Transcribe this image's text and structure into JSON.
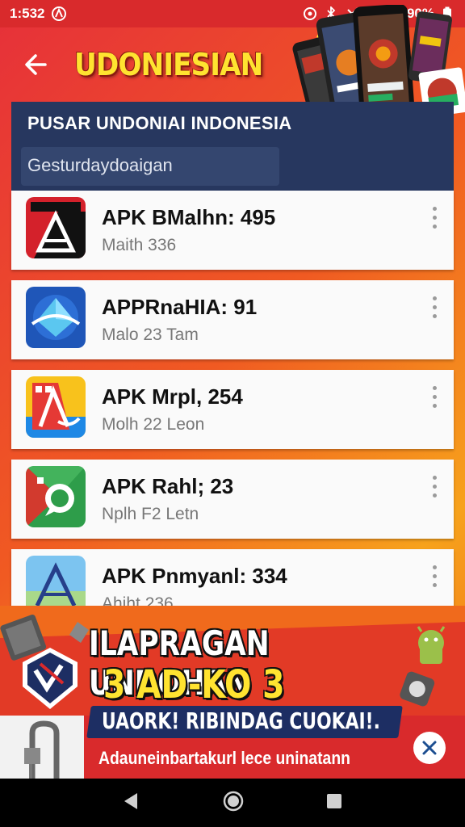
{
  "status_bar": {
    "time": "1:532",
    "battery": "90%",
    "icons": [
      "app-notification-icon",
      "sync-icon",
      "bluetooth-icon",
      "no-signal-icon",
      "wifi-icon",
      "signal-icon",
      "battery-icon"
    ]
  },
  "header": {
    "title": "UDONIESIAN",
    "subtitle": "PUSAR UNDONIAI INDONESIA",
    "search_placeholder": "Gesturdaydoaigan"
  },
  "apps": [
    {
      "name": "APK BMalhn: 495",
      "meta": "Maith 336",
      "icon": "red-a-app-icon"
    },
    {
      "name": "APPRnaHIA: 91",
      "meta": "Malo 23 Tam",
      "icon": "blue-diamond-app-icon"
    },
    {
      "name": "APK Mrpl, 254",
      "meta": "Molh 22 Leon",
      "icon": "yellow-a-app-icon"
    },
    {
      "name": "APK Rahl; 23",
      "meta": "Nplh F2 Letn",
      "icon": "green-chat-app-icon"
    },
    {
      "name": "APK Pnmyanl: 334",
      "meta": "Ahiht 236",
      "icon": "sky-a-app-icon"
    }
  ],
  "promo": {
    "line1": "ILAPRAGAN UNDOHAN",
    "line2": "3 AD-KO 3 KADA!",
    "line3": "UAORK! RIBINDAG CUOKAI!.",
    "line4": "Adauneinbartakurl lece uninatann"
  },
  "colors": {
    "status_bar": "#d92a2c",
    "navy": "#27375f",
    "accent_yellow": "#ffe330",
    "card": "#fafafa"
  },
  "nav": {
    "icons": [
      "back-triangle-icon",
      "home-circle-icon",
      "recents-square-icon"
    ]
  }
}
